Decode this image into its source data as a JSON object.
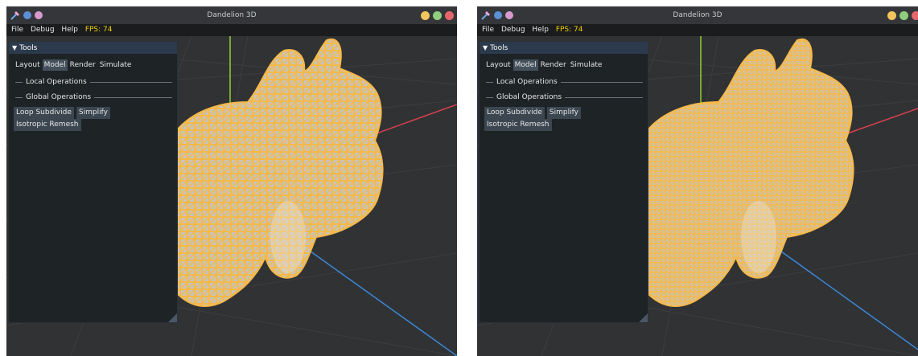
{
  "windows": [
    {
      "title": "Dandelion 3D",
      "menu": {
        "file": "File",
        "debug": "Debug",
        "help": "Help",
        "fps": "FPS: 74"
      },
      "panel": {
        "header": "Tools",
        "tabs": [
          "Layout",
          "Model",
          "Render",
          "Simulate"
        ],
        "active_tab": "Model",
        "sections": [
          "Local Operations",
          "Global Operations"
        ],
        "buttons": [
          "Loop Subdivide",
          "Simplify",
          "Isotropic Remesh"
        ]
      }
    },
    {
      "title": "Dandelion 3D",
      "menu": {
        "file": "File",
        "debug": "Debug",
        "help": "Help",
        "fps": "FPS: 74"
      },
      "panel": {
        "header": "Tools",
        "tabs": [
          "Layout",
          "Model",
          "Render",
          "Simulate"
        ],
        "active_tab": "Model",
        "sections": [
          "Local Operations",
          "Global Operations"
        ],
        "buttons": [
          "Loop Subdivide",
          "Simplify",
          "Isotropic Remesh"
        ]
      }
    }
  ],
  "colors": {
    "mesh_wire": "#f5b94a",
    "mesh_fill": "#c9c4b8",
    "axis_x": "#d8404e",
    "axis_y": "#8fd12f",
    "axis_z": "#3a88d8",
    "fps": "#f2d000"
  },
  "icons": {
    "app": "tools-icon"
  }
}
